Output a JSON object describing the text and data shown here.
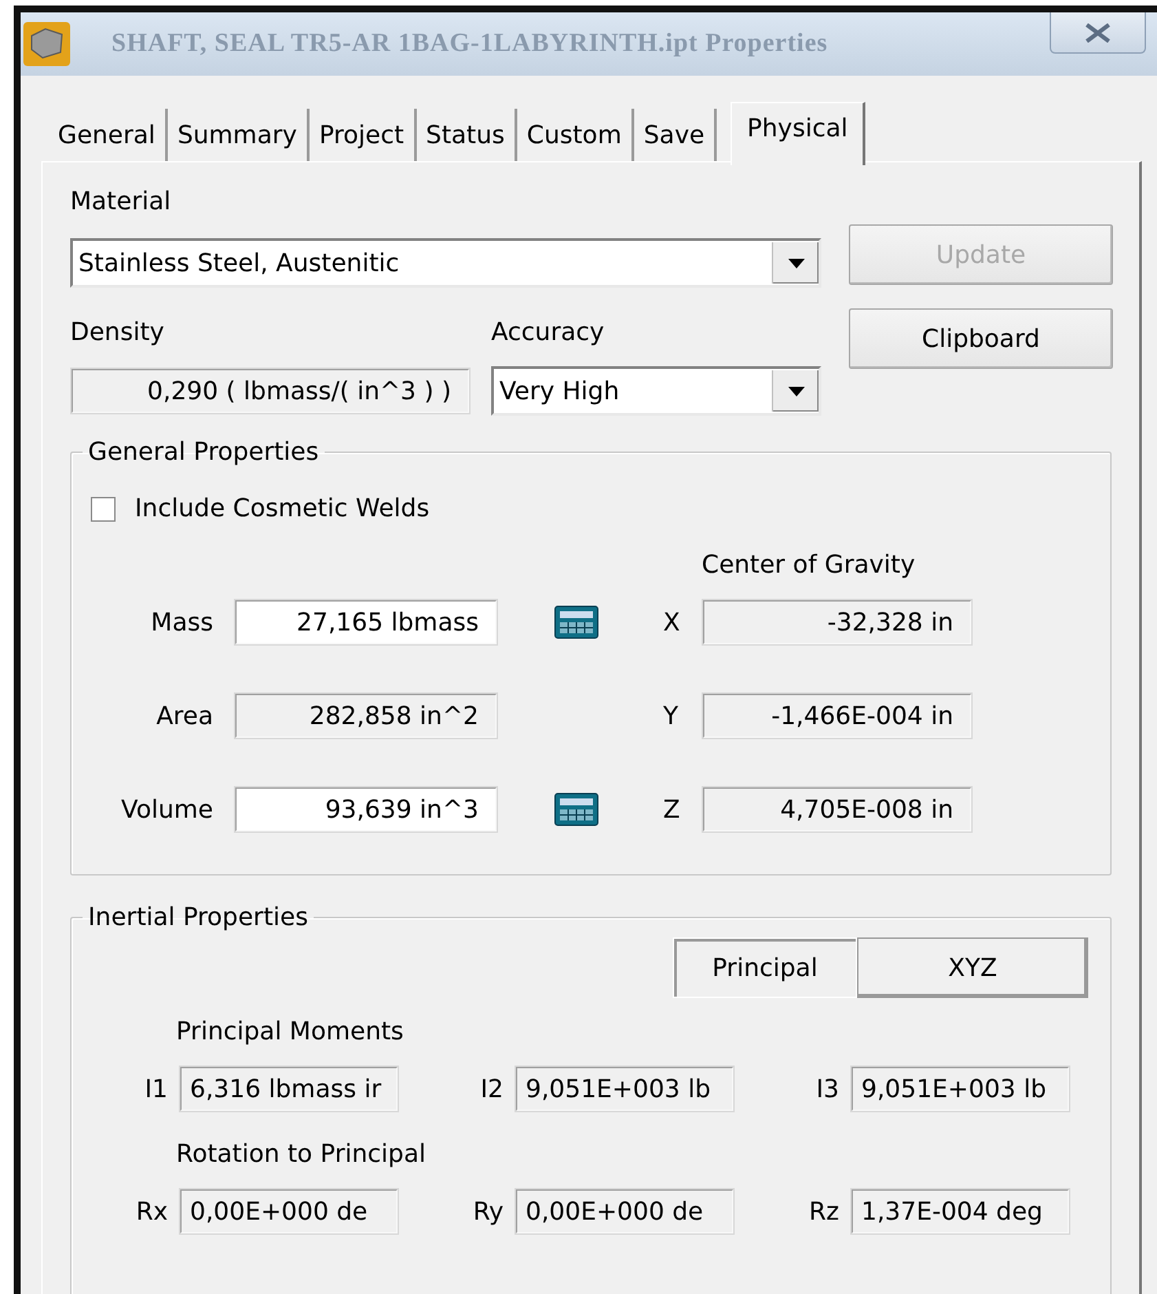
{
  "window": {
    "title": "SHAFT, SEAL TR5-AR 1BAG-1LABYRINTH.ipt Properties"
  },
  "tabs": [
    {
      "label": "General",
      "selected": false
    },
    {
      "label": "Summary",
      "selected": false
    },
    {
      "label": "Project",
      "selected": false
    },
    {
      "label": "Status",
      "selected": false
    },
    {
      "label": "Custom",
      "selected": false
    },
    {
      "label": "Save",
      "selected": false
    },
    {
      "label": "Physical",
      "selected": true
    }
  ],
  "material": {
    "label": "Material",
    "value": "Stainless Steel, Austenitic"
  },
  "buttons": [
    {
      "label": "Update",
      "disabled": true
    },
    {
      "label": "Clipboard",
      "disabled": false
    }
  ],
  "density": {
    "label": "Density",
    "value": "0,290 ( lbmass/( in^3 ) )"
  },
  "accuracy": {
    "label": "Accuracy",
    "value": "Very High"
  },
  "general_properties": {
    "title": "General Properties",
    "cosmetic_welds": {
      "label": "Include Cosmetic Welds",
      "checked": false
    },
    "center_of_gravity_label": "Center of Gravity",
    "rows": [
      {
        "label": "Mass",
        "value": "27,165 lbmass",
        "editable": true,
        "calculator": true,
        "axis": "X",
        "cog": "-32,328 in"
      },
      {
        "label": "Area",
        "value": "282,858 in^2",
        "editable": false,
        "calculator": false,
        "axis": "Y",
        "cog": "-1,466E-004 in"
      },
      {
        "label": "Volume",
        "value": "93,639 in^3",
        "editable": true,
        "calculator": true,
        "axis": "Z",
        "cog": "4,705E-008 in"
      }
    ]
  },
  "inertial_properties": {
    "title": "Inertial Properties",
    "modes": [
      {
        "label": "Principal",
        "selected": true
      },
      {
        "label": "XYZ",
        "selected": false
      }
    ],
    "sections": [
      {
        "title": "Principal Moments",
        "items": [
          {
            "label": "I1",
            "value": "6,316 lbmass ir"
          },
          {
            "label": "I2",
            "value": "9,051E+003 lb"
          },
          {
            "label": "I3",
            "value": "9,051E+003 lb"
          }
        ]
      },
      {
        "title": "Rotation to Principal",
        "items": [
          {
            "label": "Rx",
            "value": "0,00E+000 de"
          },
          {
            "label": "Ry",
            "value": "0,00E+000 de"
          },
          {
            "label": "Rz",
            "value": "1,37E-004 deg"
          }
        ]
      }
    ]
  }
}
